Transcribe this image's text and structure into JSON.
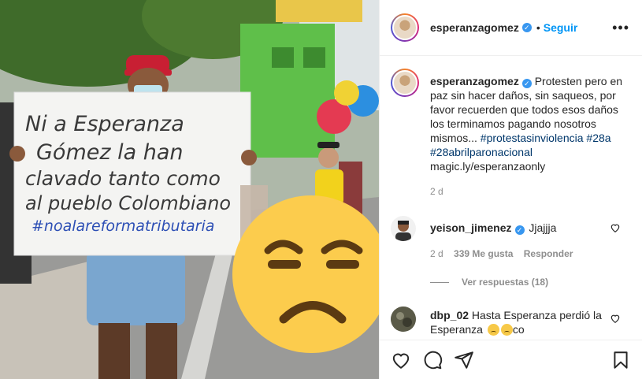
{
  "header": {
    "username": "esperanzagomez",
    "separator": "•",
    "follow_label": "Seguir",
    "more_label": "•••"
  },
  "photo": {
    "sign_lines": [
      "Ni a Esperanza",
      "Gómez la han",
      "clavado tanto como",
      "al pueblo Colombiano",
      "#noalareformatributaria"
    ]
  },
  "caption": {
    "username": "esperanzagomez",
    "text": "Protesten pero en paz sin hacer daños, sin saqueos, por favor recuerden que todos esos daños los terminamos pagando nosotros mismos... ",
    "tag1": "#protestasinviolencia",
    "tag2": "#28a",
    "tag3": "#28abrilparonacional",
    "link": "magic.ly/esperanzaonly",
    "time": "2 d"
  },
  "comments": [
    {
      "username": "yeison_jimenez",
      "text": "Jjajjja",
      "time": "2 d",
      "likes": "339 Me gusta",
      "reply_label": "Responder",
      "view_replies": "Ver respuestas (18)"
    },
    {
      "username": "dbp_02",
      "text_a": "Hasta Esperanza perdió la Esperanza ",
      "text_b": "co"
    }
  ],
  "colors": {
    "follow": "#0095f6",
    "verified": "#3897f0",
    "hashtag": "#00376b",
    "muted": "#8e8e8e"
  }
}
